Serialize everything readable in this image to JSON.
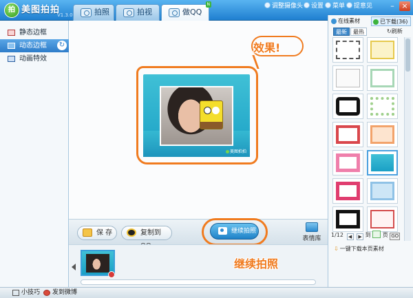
{
  "app": {
    "name": "美图拍拍",
    "version": "V1.3.0",
    "logo_char": "拍"
  },
  "tabs": [
    {
      "label": "拍照"
    },
    {
      "label": "拍视频"
    },
    {
      "label": "做QQ表情",
      "badge": "N"
    }
  ],
  "title_buttons": {
    "adjust_camera": "调整摄像头",
    "settings": "设置",
    "menu": "菜单",
    "feedback": "提意见"
  },
  "window_controls": {
    "minimize": "–",
    "close": "×"
  },
  "sidebar": {
    "items": [
      {
        "label": "静态边框"
      },
      {
        "label": "动态边框",
        "active": true
      },
      {
        "label": "动画特效"
      }
    ]
  },
  "preview": {
    "frame_brand": "美图拍拍",
    "callout_effect": "效果!"
  },
  "actions": {
    "save": "保 存",
    "copy_to_qq": "复制到QQ",
    "shoot": "继续拍照",
    "emoji_pack": "表情库"
  },
  "strip": {
    "callout_continue": "继续拍照"
  },
  "material_panel": {
    "tab_online": "在线素材",
    "tab_downloaded": "已下载(36)",
    "sub_latest": "最新",
    "sub_hot": "最热",
    "refresh": "刷新",
    "page": "1/12",
    "goto_prefix": "到",
    "goto_suffix": "页",
    "go": "GO",
    "download_all": "一键下载本页素材",
    "prev": "◀",
    "next": "▶"
  },
  "statusbar": {
    "tips": "小技巧",
    "weibo": "发到微博"
  },
  "colors": {
    "accent": "#f07b1f",
    "titlebar": "#2f8fd9",
    "frame": "#1aa0c5"
  }
}
